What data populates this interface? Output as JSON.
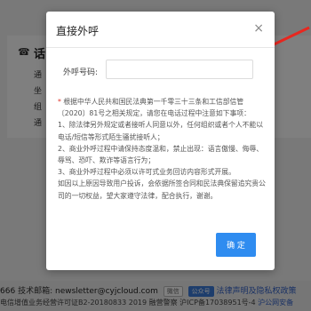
{
  "background": {
    "phone_icon": "☎",
    "heading": "话",
    "items": [
      "通",
      "坐",
      "组",
      "通"
    ],
    "footer": {
      "left_number": "666",
      "support_label": "技术邮箱:",
      "email": "newsletter@cyjcloud.com",
      "wechat_chip": "微信",
      "official_chip": "公众号",
      "legal_link": "法律声明及隐私权政策",
      "license_text": "电信增值业务经营许可证B2-20180833 2019 融营警察 沪ICP备17038951号-4",
      "site_link": "沪公网安备"
    }
  },
  "modal": {
    "title": "直接外呼",
    "close_glyph": "×",
    "phone_label": "外呼号码:",
    "phone_value": "",
    "phone_placeholder": "",
    "notice_star": "*",
    "notice_intro": "根据中华人民共和国民法典第一千零三十三条和工信部信管〔2020〕81号之相关规定，请您在电话过程中注意如下事项：",
    "notice_items": [
      "1、除法律另外规定或者接听人同意以外，任何组织或者个人不能以电话/短信等形式陌生骚扰接听人；",
      "2、商业外呼过程中请保持态度温和，禁止出现：语言傲慢、侮辱、辱骂、恐吓、欺诈等语言行为；",
      "3、商业外呼过程中必须以许可式业务回访内容形式开展。"
    ],
    "notice_footer": "如因以上原因导致用户投诉，会依据所签合同和民法典保留追究贵公司的一切权益，望大家遵守法律，配合执行，谢谢。",
    "ok_label": "确 定"
  },
  "colors": {
    "primary_button": "#2f8cf0",
    "arrow": "#e8271f",
    "warning_star": "#e0342a"
  }
}
